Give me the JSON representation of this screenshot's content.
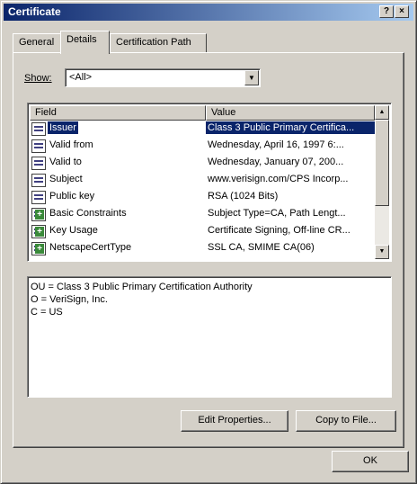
{
  "window": {
    "title": "Certificate",
    "help_label": "?",
    "close_label": "×"
  },
  "tabs": [
    {
      "label": "General"
    },
    {
      "label": "Details"
    },
    {
      "label": "Certification Path"
    }
  ],
  "show": {
    "label": "Show:",
    "value": "<All>"
  },
  "list": {
    "columns": [
      "Field",
      "Value"
    ],
    "rows": [
      {
        "field": "Issuer",
        "value": "Class 3 Public Primary Certifica...",
        "icon": "document-icon",
        "selected": true
      },
      {
        "field": "Valid from",
        "value": "Wednesday, April 16, 1997 6:...",
        "icon": "document-icon"
      },
      {
        "field": "Valid to",
        "value": "Wednesday, January 07, 200...",
        "icon": "document-icon"
      },
      {
        "field": "Subject",
        "value": "www.verisign.com/CPS Incorp...",
        "icon": "document-icon"
      },
      {
        "field": "Public key",
        "value": "RSA (1024 Bits)",
        "icon": "document-icon"
      },
      {
        "field": "Basic Constraints",
        "value": "Subject Type=CA, Path Lengt...",
        "icon": "extension-icon"
      },
      {
        "field": "Key Usage",
        "value": "Certificate Signing, Off-line CR...",
        "icon": "extension-icon"
      },
      {
        "field": "NetscapeCertType",
        "value": "SSL CA, SMIME CA(06)",
        "icon": "extension-icon"
      }
    ]
  },
  "detail": {
    "lines": [
      "OU = Class 3 Public Primary Certification Authority",
      "O = VeriSign, Inc.",
      "C = US"
    ]
  },
  "buttons": {
    "edit_properties": "Edit Properties...",
    "copy_to_file": "Copy to File...",
    "ok": "OK"
  },
  "colors": {
    "title_start": "#0a246a",
    "title_end": "#a6caf0",
    "selection": "#0a246a",
    "face": "#d4d0c8"
  }
}
